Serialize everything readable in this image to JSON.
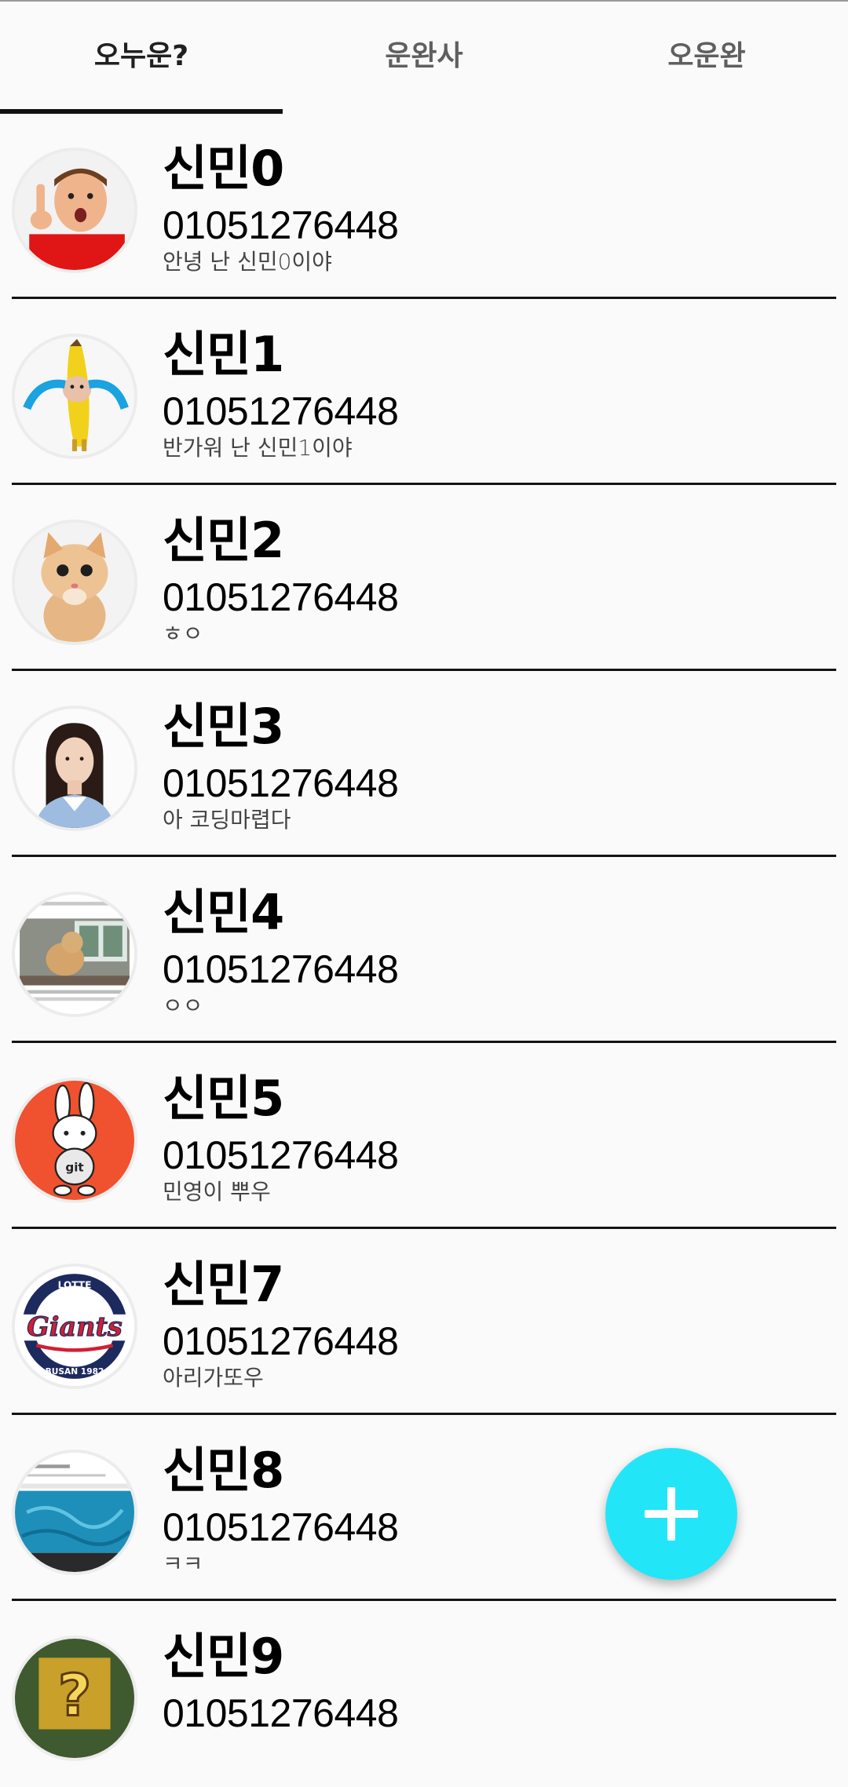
{
  "tabs": [
    {
      "label": "오누운?",
      "active": true
    },
    {
      "label": "운완사",
      "active": false
    },
    {
      "label": "오운완",
      "active": false
    }
  ],
  "contacts": [
    {
      "name": "신민0",
      "phone": "01051276448",
      "status": "안녕 난 신민0이야",
      "avatar": "boy-pointing-avatar"
    },
    {
      "name": "신민1",
      "phone": "01051276448",
      "status": "반가워 난 신민1이야",
      "avatar": "crying-banana-cat-avatar"
    },
    {
      "name": "신민2",
      "phone": "01051276448",
      "status": "ㅎㅇ",
      "avatar": "kitten-avatar"
    },
    {
      "name": "신민3",
      "phone": "01051276448",
      "status": "아 코딩마렵다",
      "avatar": "woman-portrait-avatar"
    },
    {
      "name": "신민4",
      "phone": "01051276448",
      "status": "ㅇㅇ",
      "avatar": "dog-screenshot-avatar"
    },
    {
      "name": "신민5",
      "phone": "01051276448",
      "status": "민영이 뿌우",
      "avatar": "git-rabbit-avatar"
    },
    {
      "name": "신민7",
      "phone": "01051276448",
      "status": "아리가또우",
      "avatar": "giants-logo-avatar"
    },
    {
      "name": "신민8",
      "phone": "01051276448",
      "status": "ㅋㅋ",
      "avatar": "water-screenshot-avatar"
    },
    {
      "name": "신민9",
      "phone": "01051276448",
      "status": "",
      "avatar": "question-block-avatar"
    }
  ],
  "giants_logo": {
    "top_text": "LOTTE",
    "main_text": "Giants",
    "bottom_text": "BUSAN 1982"
  },
  "rabbit_shirt_text": "git",
  "fab": {
    "icon": "plus-icon",
    "color": "#22e6f7"
  }
}
